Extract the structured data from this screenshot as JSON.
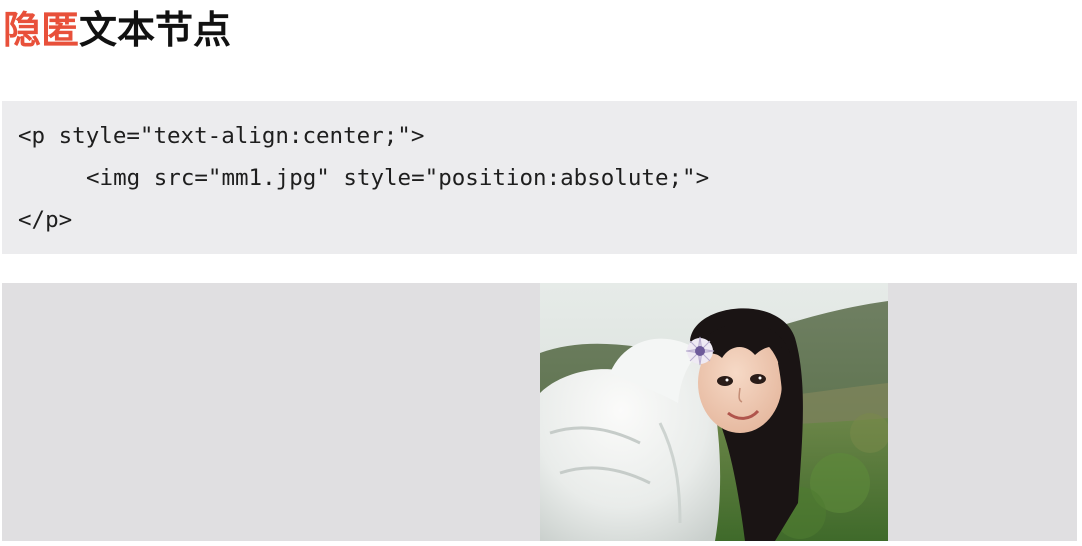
{
  "title": {
    "highlight": "隐匿",
    "rest": "文本节点"
  },
  "code": {
    "line1": "<p style=\"text-align:center;\">",
    "line2": "<img src=\"mm1.jpg\" style=\"position:absolute;\">",
    "line3": "</p>"
  },
  "demo": {
    "image_alt": "girl-in-white-jacket-photo"
  },
  "colors": {
    "title_highlight": "#e8503a",
    "title_text": "#111111",
    "code_background": "#ececee",
    "demo_background": "#e0dfe1"
  }
}
